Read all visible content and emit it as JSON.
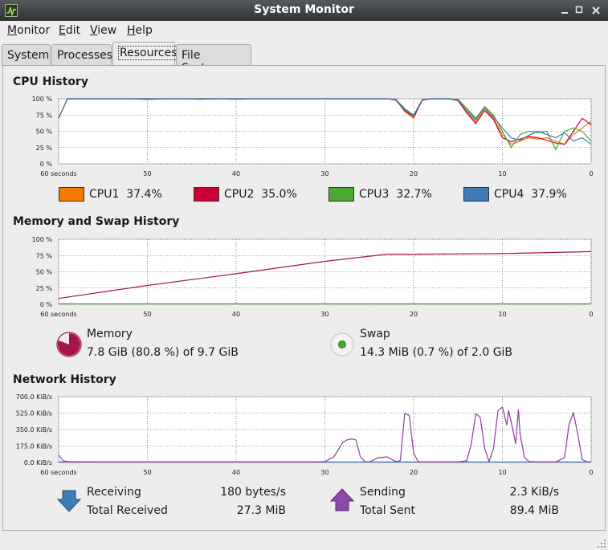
{
  "window": {
    "title": "System Monitor",
    "icon": "system-monitor-app-icon",
    "controls": [
      "minimize-icon",
      "maximize-icon",
      "close-icon"
    ]
  },
  "menu": {
    "items": [
      {
        "label": "Monitor",
        "mnemonic": "M",
        "rest": "onitor"
      },
      {
        "label": "Edit",
        "mnemonic": "E",
        "rest": "dit"
      },
      {
        "label": "View",
        "mnemonic": "V",
        "rest": "iew"
      },
      {
        "label": "Help",
        "mnemonic": "H",
        "rest": "elp"
      }
    ]
  },
  "tabs": [
    {
      "label": "System",
      "active": false
    },
    {
      "label": "Processes",
      "active": false
    },
    {
      "label": "Resources",
      "active": true
    },
    {
      "label": "File Systems",
      "active": false
    }
  ],
  "cpu": {
    "title": "CPU History",
    "y_ticks": [
      "100 %",
      "75 %",
      "50 %",
      "25 %",
      "0 %"
    ],
    "x_ticks": [
      "60 seconds",
      "50",
      "40",
      "30",
      "20",
      "10",
      "0"
    ],
    "legend": [
      {
        "name": "CPU1",
        "value": "37.4%",
        "color": "#f57900"
      },
      {
        "name": "CPU2",
        "value": "35.0%",
        "color": "#cc0033"
      },
      {
        "name": "CPU3",
        "value": "32.7%",
        "color": "#4ca835"
      },
      {
        "name": "CPU4",
        "value": "37.9%",
        "color": "#3d7cb5"
      }
    ]
  },
  "memory": {
    "title": "Memory and Swap History",
    "y_ticks": [
      "100 %",
      "75 %",
      "50 %",
      "25 %",
      "0 %"
    ],
    "x_ticks": [
      "60 seconds",
      "50",
      "40",
      "30",
      "20",
      "10",
      "0"
    ],
    "memory_label": "Memory",
    "memory_value": "7.8 GiB (80.8 %) of 9.7 GiB",
    "memory_fraction": 0.808,
    "memory_color": "#a4154a",
    "swap_label": "Swap",
    "swap_value": "14.3 MiB (0.7 %) of 2.0 GiB",
    "swap_fraction": 0.007,
    "swap_color": "#4ca835"
  },
  "network": {
    "title": "Network History",
    "y_ticks": [
      "700.0 KiB/s",
      "525.0 KiB/s",
      "350.0 KiB/s",
      "175.0 KiB/s",
      "0.0 KiB/s"
    ],
    "x_ticks": [
      "60 seconds",
      "50",
      "40",
      "30",
      "20",
      "10",
      "0"
    ],
    "receiving_label": "Receiving",
    "receiving_value": "180 bytes/s",
    "total_received_label": "Total Received",
    "total_received_value": "27.3 MiB",
    "sending_label": "Sending",
    "sending_value": "2.3 KiB/s",
    "total_sent_label": "Total Sent",
    "total_sent_value": "89.4 MiB",
    "receiving_color": "#3d7cb5",
    "sending_color": "#8a3d9a"
  },
  "chart_data": [
    {
      "type": "line",
      "title": "CPU History",
      "x": [
        60,
        59,
        58,
        56,
        54,
        52,
        50,
        48,
        46,
        44,
        42,
        40,
        38,
        36,
        34,
        32,
        30,
        28,
        26,
        24,
        23,
        22,
        21,
        20,
        19,
        18,
        17,
        16,
        15,
        14,
        13,
        12,
        11,
        10,
        9,
        8,
        7,
        6,
        5,
        4,
        3,
        2,
        1,
        0
      ],
      "xlim": [
        60,
        0
      ],
      "ylim": [
        0,
        100
      ],
      "series": [
        {
          "name": "CPU1",
          "values": [
            70,
            100,
            100,
            100,
            100,
            100,
            100,
            100,
            100,
            99,
            100,
            100,
            100,
            100,
            100,
            100,
            100,
            100,
            100,
            100,
            100,
            99,
            80,
            70,
            99,
            100,
            100,
            100,
            98,
            80,
            65,
            85,
            70,
            45,
            30,
            35,
            40,
            38,
            40,
            35,
            30,
            45,
            55,
            65
          ]
        },
        {
          "name": "CPU2",
          "values": [
            70,
            100,
            100,
            100,
            100,
            100,
            99,
            100,
            100,
            100,
            100,
            100,
            100,
            100,
            100,
            100,
            100,
            100,
            100,
            100,
            100,
            98,
            82,
            72,
            98,
            100,
            100,
            100,
            97,
            78,
            62,
            82,
            68,
            40,
            34,
            38,
            42,
            40,
            36,
            32,
            30,
            50,
            70,
            60
          ]
        },
        {
          "name": "CPU3",
          "values": [
            70,
            100,
            100,
            100,
            100,
            100,
            100,
            100,
            100,
            100,
            100,
            99,
            100,
            100,
            100,
            100,
            100,
            100,
            100,
            100,
            100,
            99,
            85,
            75,
            99,
            100,
            100,
            100,
            99,
            85,
            70,
            88,
            75,
            50,
            25,
            45,
            50,
            48,
            50,
            22,
            50,
            55,
            50,
            35
          ]
        },
        {
          "name": "CPU4",
          "values": [
            70,
            100,
            100,
            100,
            100,
            100,
            100,
            100,
            100,
            100,
            100,
            100,
            100,
            100,
            100,
            100,
            100,
            100,
            100,
            100,
            100,
            99,
            83,
            74,
            99,
            100,
            100,
            100,
            98,
            82,
            68,
            86,
            72,
            55,
            40,
            36,
            44,
            50,
            45,
            40,
            48,
            35,
            40,
            30
          ]
        }
      ]
    },
    {
      "type": "line",
      "title": "Memory and Swap History",
      "x": [
        60,
        50,
        40,
        30,
        23,
        20,
        10,
        0
      ],
      "xlim": [
        60,
        0
      ],
      "ylim": [
        0,
        100
      ],
      "series": [
        {
          "name": "Memory",
          "values": [
            9,
            29,
            47,
            66,
            77,
            77,
            78,
            81
          ]
        },
        {
          "name": "Swap",
          "values": [
            0.7,
            0.7,
            0.7,
            0.7,
            0.7,
            0.7,
            0.7,
            0.7
          ]
        }
      ]
    },
    {
      "type": "line",
      "title": "Network History",
      "x": [
        60,
        59.5,
        59,
        58,
        55,
        50,
        40,
        32,
        31,
        30,
        29,
        28,
        27.5,
        27,
        26.5,
        26,
        25.5,
        25,
        24,
        23,
        22,
        21.5,
        21,
        20.5,
        20,
        19.5,
        19,
        18,
        17,
        16,
        15,
        14,
        13.5,
        13,
        12.5,
        12,
        11.5,
        11,
        10.5,
        10,
        9.5,
        9.3,
        9,
        8.5,
        8.2,
        8,
        7.5,
        7,
        6,
        5,
        4,
        3,
        2.5,
        2,
        1.5,
        1,
        0.5,
        0
      ],
      "xlim": [
        60,
        0
      ],
      "ylim": [
        0,
        700
      ],
      "series": [
        {
          "name": "Receiving",
          "values": [
            80,
            20,
            10,
            8,
            5,
            5,
            5,
            5,
            5,
            5,
            5,
            5,
            5,
            5,
            5,
            5,
            5,
            5,
            5,
            5,
            5,
            5,
            5,
            5,
            5,
            5,
            5,
            5,
            5,
            5,
            5,
            5,
            5,
            5,
            5,
            5,
            5,
            5,
            5,
            5,
            5,
            5,
            5,
            5,
            5,
            5,
            5,
            5,
            5,
            5,
            5,
            5,
            5,
            5,
            5,
            5,
            5,
            5
          ]
        },
        {
          "name": "Sending",
          "values": [
            5,
            5,
            5,
            5,
            5,
            5,
            5,
            5,
            5,
            10,
            60,
            210,
            240,
            250,
            240,
            60,
            10,
            5,
            50,
            60,
            10,
            20,
            520,
            500,
            100,
            10,
            5,
            5,
            5,
            5,
            5,
            20,
            200,
            520,
            480,
            150,
            10,
            150,
            550,
            590,
            400,
            550,
            430,
            200,
            560,
            300,
            50,
            10,
            5,
            5,
            5,
            50,
            400,
            530,
            300,
            30,
            10,
            5
          ]
        }
      ]
    }
  ]
}
